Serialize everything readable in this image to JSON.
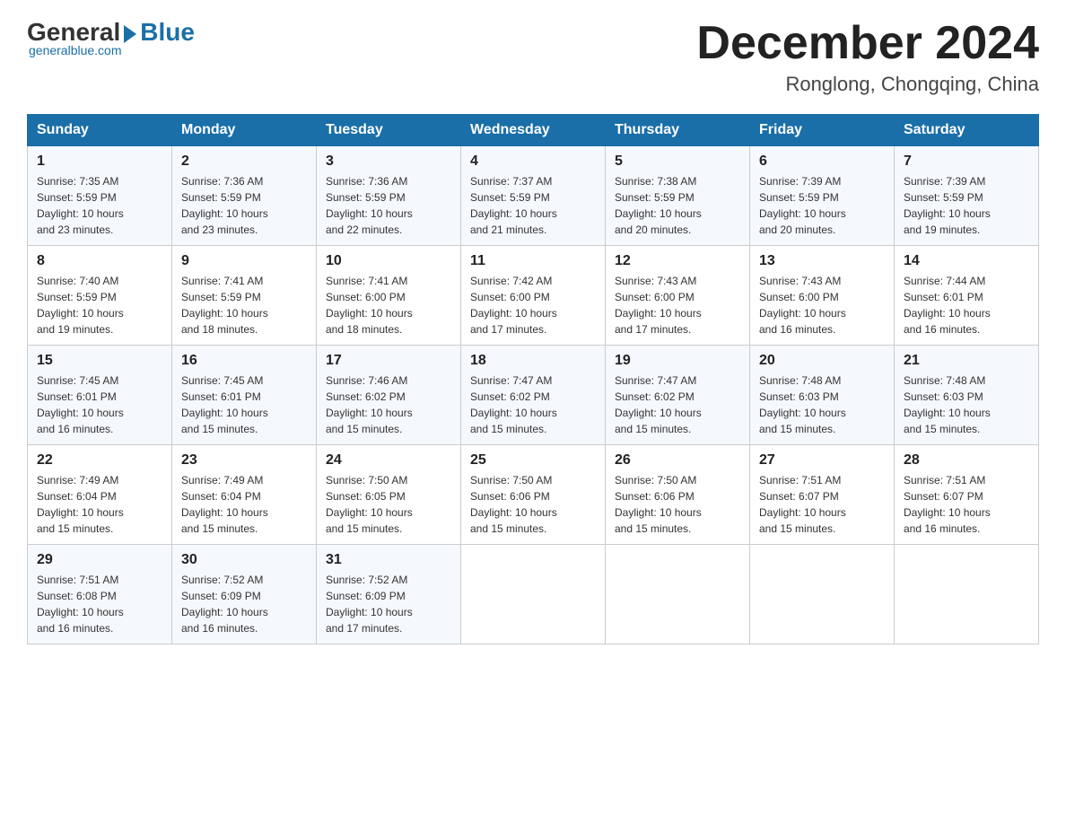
{
  "logo": {
    "general": "General",
    "blue": "Blue",
    "tagline": "generalblue.com"
  },
  "title": "December 2024",
  "subtitle": "Ronglong, Chongqing, China",
  "weekdays": [
    "Sunday",
    "Monday",
    "Tuesday",
    "Wednesday",
    "Thursday",
    "Friday",
    "Saturday"
  ],
  "weeks": [
    [
      {
        "day": "1",
        "sunrise": "7:35 AM",
        "sunset": "5:59 PM",
        "daylight": "10 hours and 23 minutes."
      },
      {
        "day": "2",
        "sunrise": "7:36 AM",
        "sunset": "5:59 PM",
        "daylight": "10 hours and 23 minutes."
      },
      {
        "day": "3",
        "sunrise": "7:36 AM",
        "sunset": "5:59 PM",
        "daylight": "10 hours and 22 minutes."
      },
      {
        "day": "4",
        "sunrise": "7:37 AM",
        "sunset": "5:59 PM",
        "daylight": "10 hours and 21 minutes."
      },
      {
        "day": "5",
        "sunrise": "7:38 AM",
        "sunset": "5:59 PM",
        "daylight": "10 hours and 20 minutes."
      },
      {
        "day": "6",
        "sunrise": "7:39 AM",
        "sunset": "5:59 PM",
        "daylight": "10 hours and 20 minutes."
      },
      {
        "day": "7",
        "sunrise": "7:39 AM",
        "sunset": "5:59 PM",
        "daylight": "10 hours and 19 minutes."
      }
    ],
    [
      {
        "day": "8",
        "sunrise": "7:40 AM",
        "sunset": "5:59 PM",
        "daylight": "10 hours and 19 minutes."
      },
      {
        "day": "9",
        "sunrise": "7:41 AM",
        "sunset": "5:59 PM",
        "daylight": "10 hours and 18 minutes."
      },
      {
        "day": "10",
        "sunrise": "7:41 AM",
        "sunset": "6:00 PM",
        "daylight": "10 hours and 18 minutes."
      },
      {
        "day": "11",
        "sunrise": "7:42 AM",
        "sunset": "6:00 PM",
        "daylight": "10 hours and 17 minutes."
      },
      {
        "day": "12",
        "sunrise": "7:43 AM",
        "sunset": "6:00 PM",
        "daylight": "10 hours and 17 minutes."
      },
      {
        "day": "13",
        "sunrise": "7:43 AM",
        "sunset": "6:00 PM",
        "daylight": "10 hours and 16 minutes."
      },
      {
        "day": "14",
        "sunrise": "7:44 AM",
        "sunset": "6:01 PM",
        "daylight": "10 hours and 16 minutes."
      }
    ],
    [
      {
        "day": "15",
        "sunrise": "7:45 AM",
        "sunset": "6:01 PM",
        "daylight": "10 hours and 16 minutes."
      },
      {
        "day": "16",
        "sunrise": "7:45 AM",
        "sunset": "6:01 PM",
        "daylight": "10 hours and 15 minutes."
      },
      {
        "day": "17",
        "sunrise": "7:46 AM",
        "sunset": "6:02 PM",
        "daylight": "10 hours and 15 minutes."
      },
      {
        "day": "18",
        "sunrise": "7:47 AM",
        "sunset": "6:02 PM",
        "daylight": "10 hours and 15 minutes."
      },
      {
        "day": "19",
        "sunrise": "7:47 AM",
        "sunset": "6:02 PM",
        "daylight": "10 hours and 15 minutes."
      },
      {
        "day": "20",
        "sunrise": "7:48 AM",
        "sunset": "6:03 PM",
        "daylight": "10 hours and 15 minutes."
      },
      {
        "day": "21",
        "sunrise": "7:48 AM",
        "sunset": "6:03 PM",
        "daylight": "10 hours and 15 minutes."
      }
    ],
    [
      {
        "day": "22",
        "sunrise": "7:49 AM",
        "sunset": "6:04 PM",
        "daylight": "10 hours and 15 minutes."
      },
      {
        "day": "23",
        "sunrise": "7:49 AM",
        "sunset": "6:04 PM",
        "daylight": "10 hours and 15 minutes."
      },
      {
        "day": "24",
        "sunrise": "7:50 AM",
        "sunset": "6:05 PM",
        "daylight": "10 hours and 15 minutes."
      },
      {
        "day": "25",
        "sunrise": "7:50 AM",
        "sunset": "6:06 PM",
        "daylight": "10 hours and 15 minutes."
      },
      {
        "day": "26",
        "sunrise": "7:50 AM",
        "sunset": "6:06 PM",
        "daylight": "10 hours and 15 minutes."
      },
      {
        "day": "27",
        "sunrise": "7:51 AM",
        "sunset": "6:07 PM",
        "daylight": "10 hours and 15 minutes."
      },
      {
        "day": "28",
        "sunrise": "7:51 AM",
        "sunset": "6:07 PM",
        "daylight": "10 hours and 16 minutes."
      }
    ],
    [
      {
        "day": "29",
        "sunrise": "7:51 AM",
        "sunset": "6:08 PM",
        "daylight": "10 hours and 16 minutes."
      },
      {
        "day": "30",
        "sunrise": "7:52 AM",
        "sunset": "6:09 PM",
        "daylight": "10 hours and 16 minutes."
      },
      {
        "day": "31",
        "sunrise": "7:52 AM",
        "sunset": "6:09 PM",
        "daylight": "10 hours and 17 minutes."
      },
      null,
      null,
      null,
      null
    ]
  ]
}
